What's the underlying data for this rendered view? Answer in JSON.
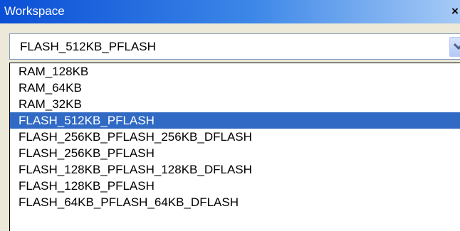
{
  "window": {
    "title": "Workspace",
    "close_label": "×"
  },
  "combo": {
    "value": "FLASH_512KB_PFLASH"
  },
  "dropdown": {
    "items": [
      {
        "label": "RAM_128KB"
      },
      {
        "label": "RAM_64KB"
      },
      {
        "label": "RAM_32KB"
      },
      {
        "label": "FLASH_512KB_PFLASH",
        "selected": true
      },
      {
        "label": "FLASH_256KB_PFLASH_256KB_DFLASH"
      },
      {
        "label": "FLASH_256KB_PFLASH"
      },
      {
        "label": "FLASH_128KB_PFLASH_128KB_DFLASH"
      },
      {
        "label": "FLASH_128KB_PFLASH"
      },
      {
        "label": "FLASH_64KB_PFLASH_64KB_DFLASH"
      }
    ]
  },
  "colors": {
    "selection": "#316ac5",
    "titlebar": "#0a4fd6"
  },
  "icons": {
    "dropdown_arrow": "chevron-down-icon",
    "close": "close-icon"
  }
}
